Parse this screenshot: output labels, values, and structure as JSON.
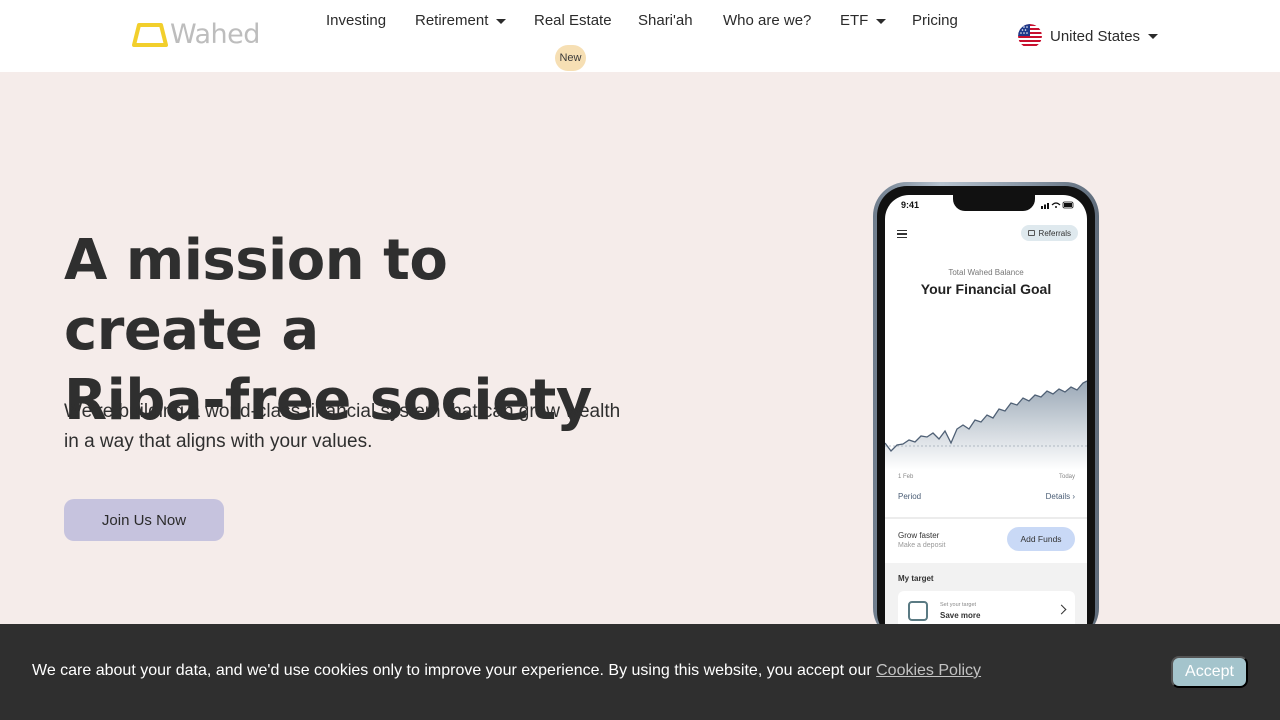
{
  "nav": {
    "logo_text": "Wahed",
    "items": [
      {
        "label": "Investing",
        "dropdown": false
      },
      {
        "label": "Retirement",
        "dropdown": true
      },
      {
        "label": "Real Estate",
        "dropdown": false
      },
      {
        "label": "Shari'ah",
        "dropdown": false
      },
      {
        "label": "Who are we?",
        "dropdown": false
      },
      {
        "label": "ETF",
        "dropdown": true
      },
      {
        "label": "Pricing",
        "dropdown": false
      }
    ],
    "new_badge": "New",
    "country": "United States"
  },
  "hero": {
    "title_line1": "A mission to create a",
    "title_line2": "Riba-free society",
    "subtitle": "We’re building a world-class financial system that can grow wealth in a way that aligns with your values.",
    "cta_label": "Join Us Now"
  },
  "phone": {
    "time": "9:41",
    "referrals": "Referrals",
    "balance_label": "Total Wahed Balance",
    "goal": "Your Financial Goal",
    "axis_start": "1 Feb",
    "axis_end": "Today",
    "period": "Period",
    "details": "Details",
    "grow_title": "Grow faster",
    "grow_sub": "Make a deposit",
    "add_funds": "Add Funds",
    "target_label": "My target",
    "target_small": "Set your target",
    "target_main": "Save more"
  },
  "cookie": {
    "text": "We care about your data, and we'd use cookies only to improve your experience. By using this website, you accept our",
    "link": "Cookies Policy",
    "accept": "Accept"
  },
  "colors": {
    "background": "#f5ecea",
    "cta": "#c6c3de",
    "logo_mark": "#f2cf2c",
    "cookie_bg": "#2f2f2f",
    "accept": "#a4c4cc",
    "badge": "#f6dfb4"
  }
}
